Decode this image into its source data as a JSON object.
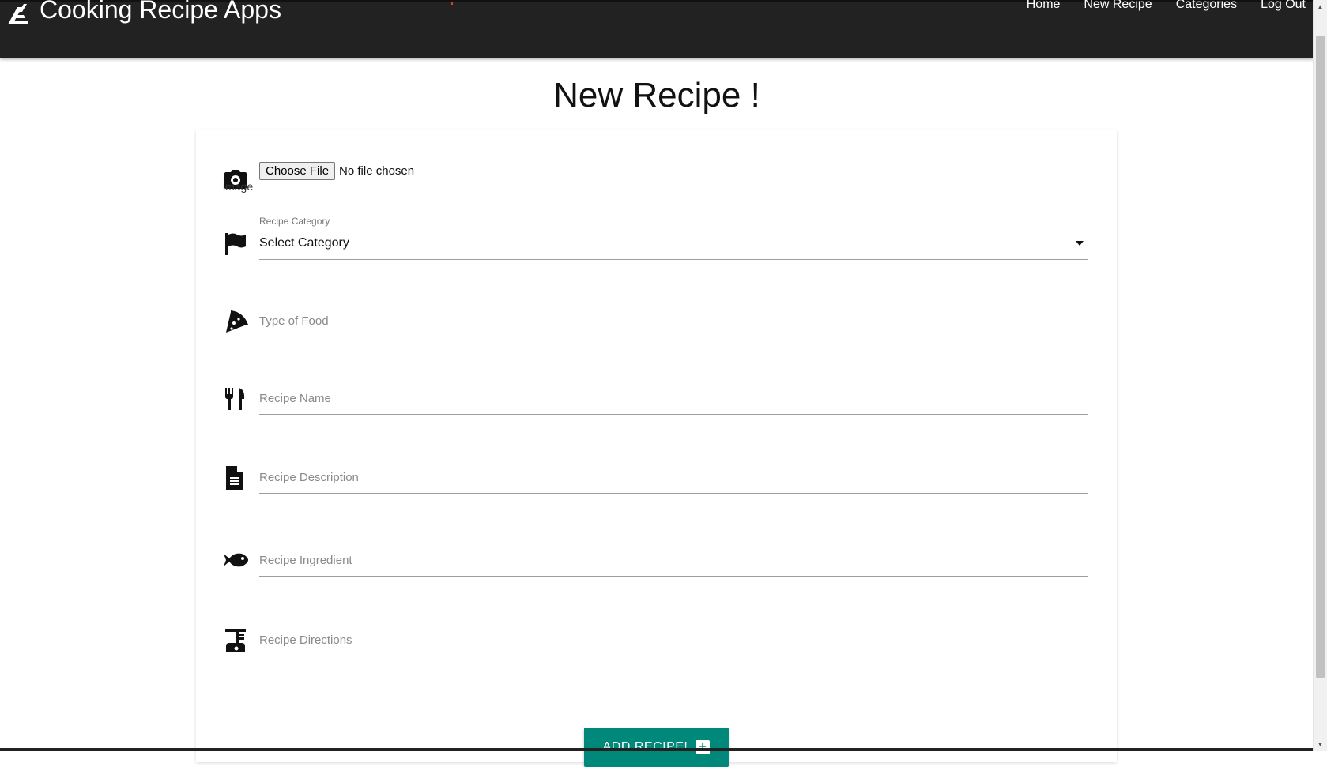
{
  "header": {
    "app_title": "Cooking Recipe Apps",
    "nav": [
      "Home",
      "New Recipe",
      "Categories",
      "Log Out"
    ]
  },
  "page_title": "New Recipe !",
  "form": {
    "file": {
      "button_label": "Choose File",
      "status": "No file chosen",
      "image_alt": "image"
    },
    "category": {
      "label": "Recipe Category",
      "value": "Select Category"
    },
    "type_of_food": {
      "placeholder": "Type of Food"
    },
    "recipe_name": {
      "placeholder": "Recipe Name"
    },
    "recipe_description": {
      "placeholder": "Recipe Description"
    },
    "recipe_ingredient": {
      "placeholder": "Recipe Ingredient"
    },
    "recipe_directions": {
      "placeholder": "Recipe Directions"
    },
    "submit_label": "ADD RECIPE!"
  },
  "colors": {
    "navbar": "#222222",
    "accent": "#00897b"
  },
  "icons": [
    "camera-icon",
    "flag-icon",
    "pizza-icon",
    "utensils-icon",
    "document-icon",
    "fish-icon",
    "blender-icon",
    "plus-icon"
  ]
}
